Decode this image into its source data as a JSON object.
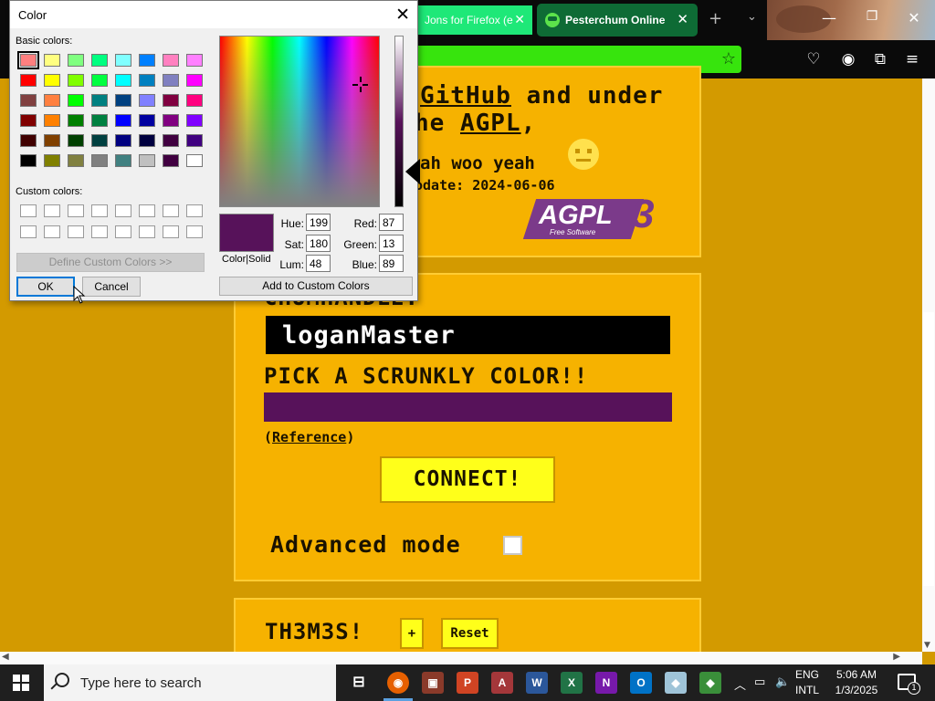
{
  "browser": {
    "tab_left_label": "Jons for Firefox (e",
    "tab_active_label": "Pesterchum Online",
    "new_tab_icon": "plus-icon",
    "tab_list_icon": "chevron-down-icon"
  },
  "page": {
    "line_github_prefix": "",
    "github_link": "GitHub",
    "line_github_suffix": " and under",
    "line_agpl_prefix": "he ",
    "agpl_link": "AGPL",
    "line_agpl_suffix": ",",
    "woo_line": "ah woo yeah",
    "update_line": "odate: 2024-06-06",
    "agpl_logo_text": "AGPL",
    "agpl_logo_sub": "Free Software",
    "agpl_logo_version": "3",
    "chumhandle_label": "CHUMHANDLE:",
    "chumhandle_value": "loganMaster",
    "color_label": "PICK A SCRUNKLY COLOR!!",
    "selected_color": "#57125a",
    "reference_open": "(",
    "reference_link": "Reference",
    "reference_close": ")",
    "connect_label": "CONNECT!",
    "advanced_mode_label": "Advanced mode",
    "themes_label": "TH3M3S!",
    "add_theme_label": "+",
    "reset_label": "Reset"
  },
  "dialog": {
    "title": "Color",
    "close_glyph": "✕",
    "basic_colors_label": "Basic colors:",
    "custom_colors_label": "Custom colors:",
    "define_custom_label": "Define Custom Colors >>",
    "ok_label": "OK",
    "cancel_label": "Cancel",
    "add_custom_label": "Add to Custom Colors",
    "color_solid_label": "Color|Solid",
    "hue_label": "Hue:",
    "sat_label": "Sat:",
    "lum_label": "Lum:",
    "red_label": "Red:",
    "green_label": "Green:",
    "blue_label": "Blue:",
    "hue": "199",
    "sat": "180",
    "lum": "48",
    "red": "87",
    "green": "13",
    "blue": "89",
    "basic_colors": [
      [
        "#ff8080",
        "#ffff80",
        "#80ff80",
        "#00ff80",
        "#80ffff",
        "#0080ff",
        "#ff80c0",
        "#ff80ff"
      ],
      [
        "#ff0000",
        "#ffff00",
        "#80ff00",
        "#00ff40",
        "#00ffff",
        "#0080c0",
        "#8080c0",
        "#ff00ff"
      ],
      [
        "#804040",
        "#ff8040",
        "#00ff00",
        "#008080",
        "#004080",
        "#8080ff",
        "#800040",
        "#ff0080"
      ],
      [
        "#800000",
        "#ff8000",
        "#008000",
        "#008040",
        "#0000ff",
        "#0000a0",
        "#800080",
        "#8000ff"
      ],
      [
        "#400000",
        "#804000",
        "#004000",
        "#004040",
        "#000080",
        "#000040",
        "#400040",
        "#400080"
      ],
      [
        "#000000",
        "#808000",
        "#808040",
        "#808080",
        "#408080",
        "#c0c0c0",
        "#400040",
        "#ffffff"
      ]
    ]
  },
  "taskbar": {
    "search_placeholder": "Type here to search",
    "lang_line1": "ENG",
    "lang_line2": "INTL",
    "time": "5:06 AM",
    "date": "1/3/2025",
    "notification_count": "1"
  }
}
